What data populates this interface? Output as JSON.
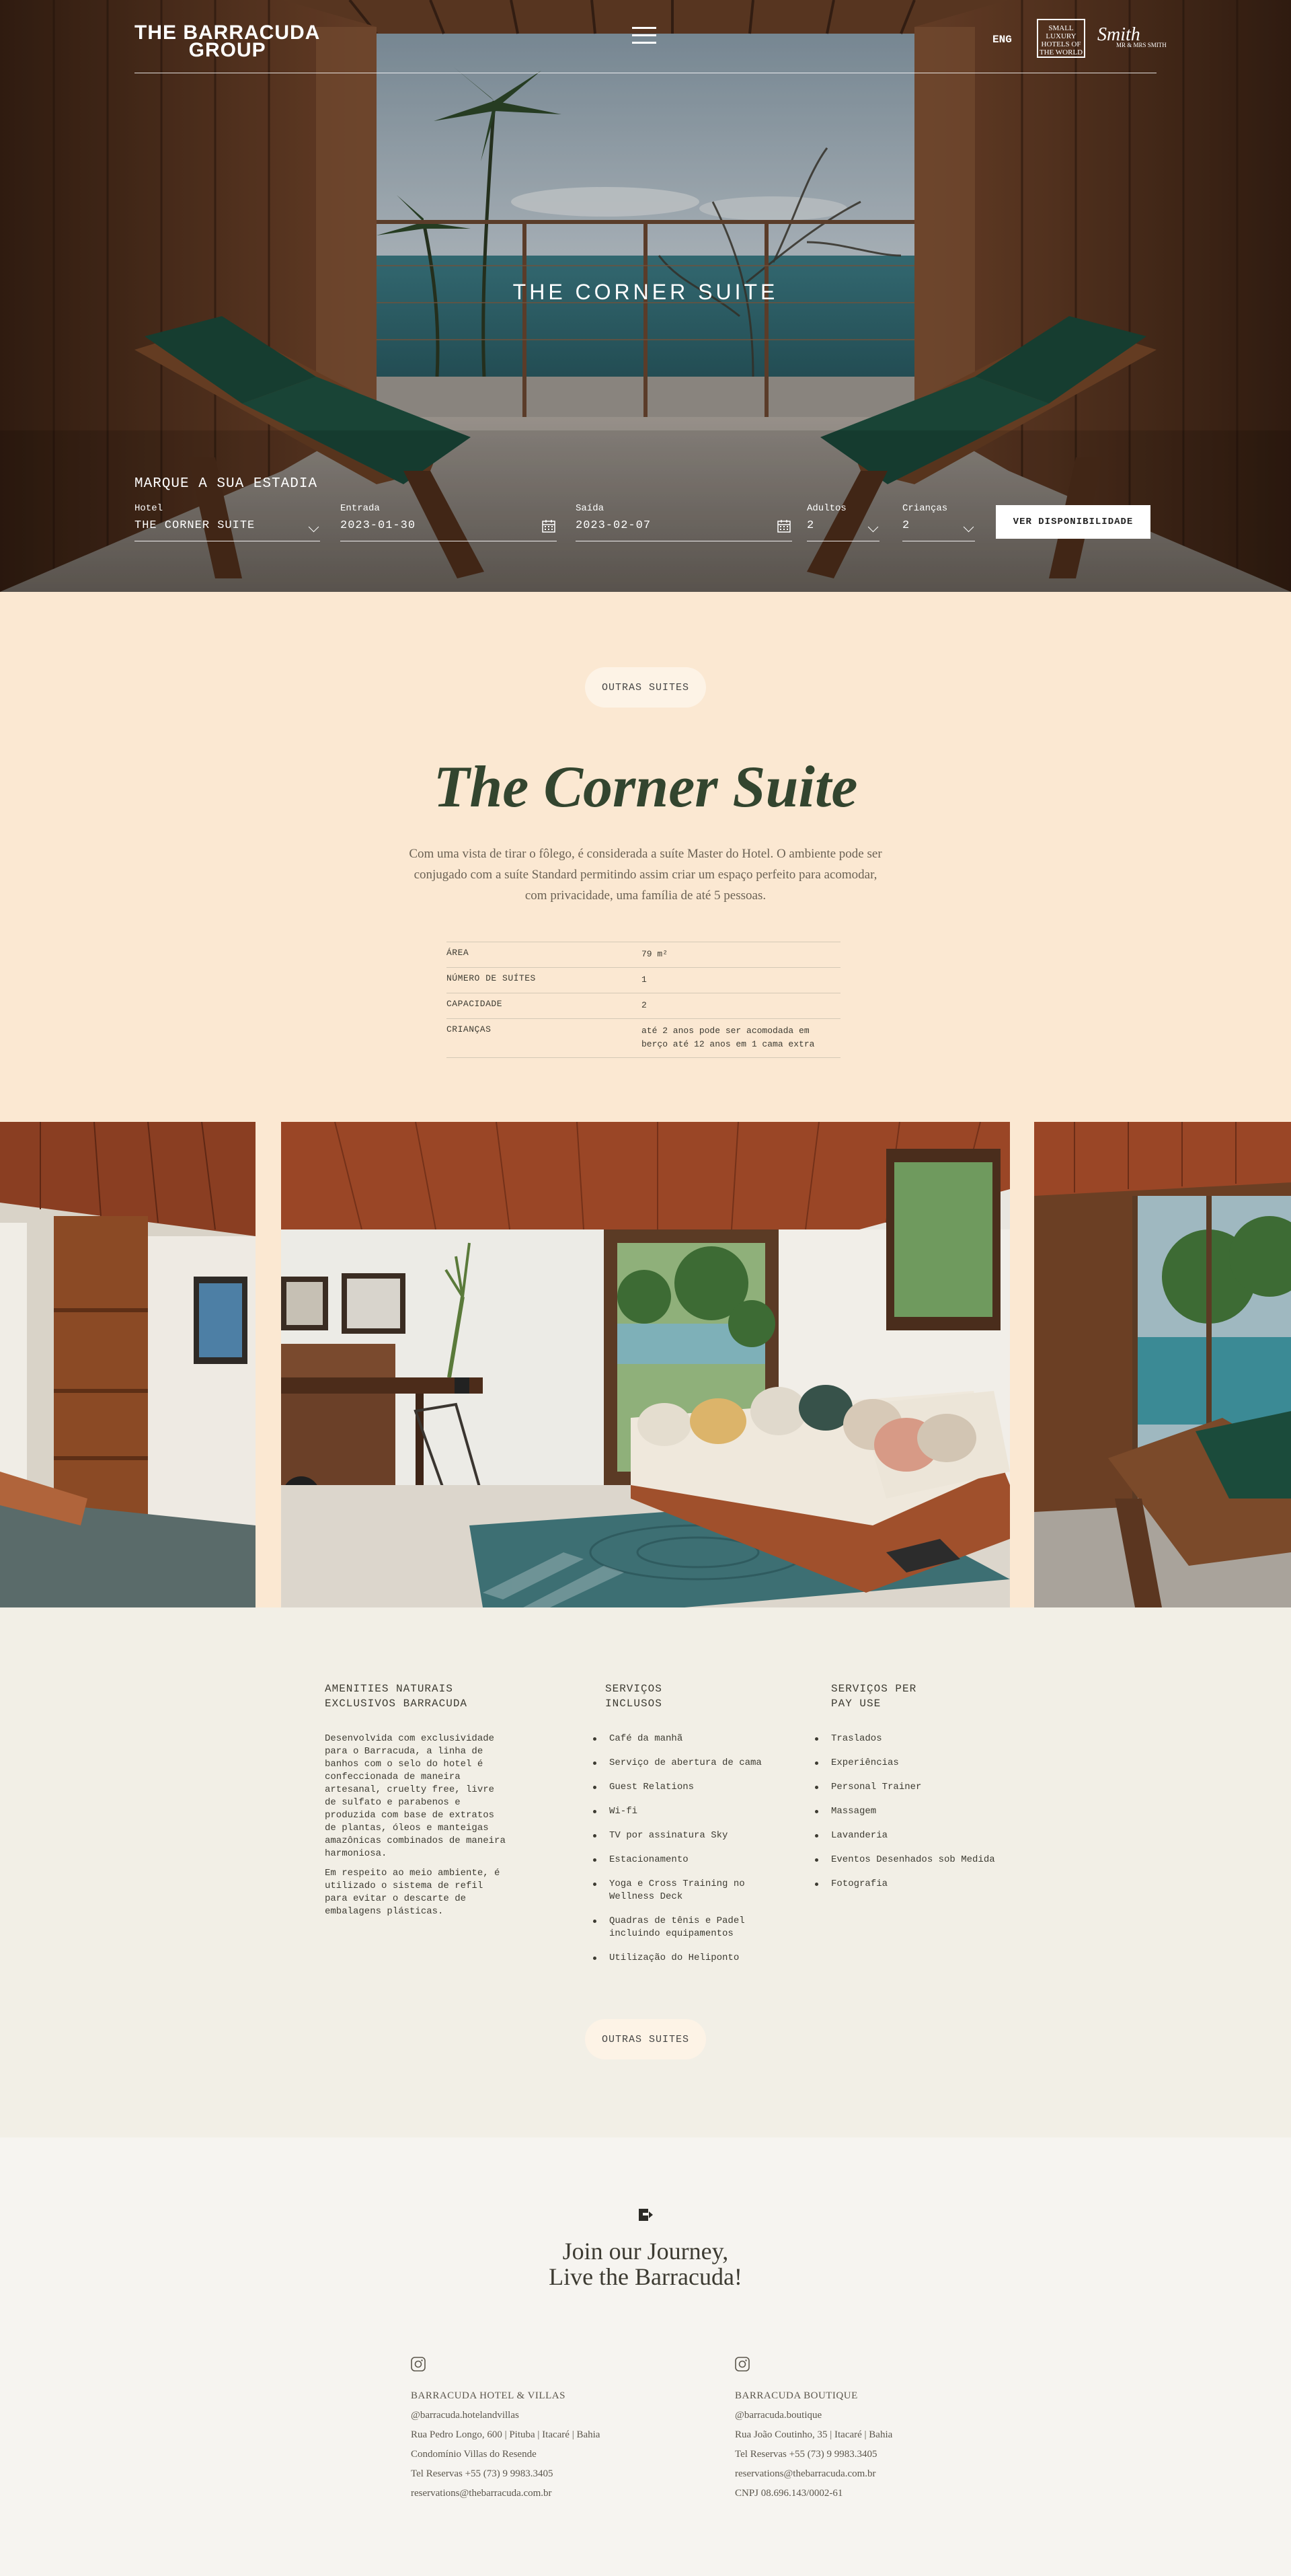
{
  "header": {
    "logo_line1": "THE BARRACUDA",
    "logo_line2": "GROUP",
    "menu_icon": "hamburger-menu-icon",
    "language": "ENG",
    "slh_logo": "SMALL LUXURY HOTELS OF THE WORLD",
    "smith_logo": "Smith",
    "smith_sub": "MR & MRS SMITH"
  },
  "hero": {
    "title": "THE CORNER SUITE"
  },
  "booking": {
    "heading": "MARQUE A SUA ESTADIA",
    "hotel_label": "Hotel",
    "hotel_value": "THE CORNER SUITE",
    "checkin_label": "Entrada",
    "checkin_value": "2023-01-30",
    "checkout_label": "Saída",
    "checkout_value": "2023-02-07",
    "adults_label": "Adultos",
    "adults_value": "2",
    "children_label": "Crianças",
    "children_value": "2",
    "button": "VER DISPONIBILIDADE"
  },
  "intro": {
    "pill_label": "OUTRAS SUITES",
    "title": "The Corner Suite",
    "description": "Com uma vista de tirar o fôlego, é considerada a suíte Master do Hotel. O ambiente pode ser conjugado com a suíte Standard permitindo assim criar um espaço perfeito para acomodar, com privacidade, uma família de até 5 pessoas.",
    "specs": [
      {
        "label": "ÁREA",
        "value": "79 m²"
      },
      {
        "label": "NÚMERO DE SUÍTES",
        "value": "1"
      },
      {
        "label": "CAPACIDADE",
        "value": "2"
      },
      {
        "label": "CRIANÇAS",
        "value": "até 2 anos pode ser acomodada em berço até 12 anos em 1 cama extra"
      }
    ]
  },
  "amenities": {
    "natural_heading": "AMENITIES NATURAIS EXCLUSIVOS BARRACUDA",
    "natural_p1": "Desenvolvida com exclusividade para o Barracuda, a linha de banhos com o selo do hotel é confeccionada de maneira artesanal, cruelty free, livre de sulfato e parabenos e produzida com base de extratos de plantas, óleos e manteigas amazônicas combinados de maneira harmoniosa.",
    "natural_p2": "Em respeito ao meio ambiente, é utilizado o sistema de refil para evitar o descarte de embalagens plásticas.",
    "included_heading": "SERVIÇOS INCLUSOS",
    "included": [
      "Café da manhã",
      "Serviço de abertura de cama",
      "Guest Relations",
      "Wi-fi",
      "TV por assinatura Sky",
      "Estacionamento",
      "Yoga e Cross Training no Wellness Deck",
      "Quadras de tênis e Padel incluindo equipamentos",
      "Utilização do Heliponto"
    ],
    "payperuse_heading": "SERVIÇOS PER PAY USE",
    "payperuse": [
      "Traslados",
      "Experiências",
      "Personal Trainer",
      "Massagem",
      "Lavanderia",
      "Eventos Desenhados sob Medida",
      "Fotografia"
    ],
    "pill_label": "OUTRAS SUITES"
  },
  "footer": {
    "mark_icon": "barracuda-mark-icon",
    "journey_line1": "Join our Journey,",
    "journey_line2": "Live the Barracuda!",
    "left": {
      "icon": "instagram-icon",
      "name": "BARRACUDA HOTEL & VILLAS",
      "handle": "@barracuda.hotelandvillas",
      "address": "Rua Pedro Longo, 600 | Pituba | Itacaré | Bahia",
      "condo": "Condomínio Villas do Resende",
      "phone": "Tel Reservas +55 (73) 9 9983.3405",
      "email": "reservations@thebarracuda.com.br"
    },
    "right": {
      "icon": "instagram-icon",
      "name": "BARRACUDA BOUTIQUE",
      "handle": "@barracuda.boutique",
      "address": "Rua João Coutinho, 35 | Itacaré | Bahia",
      "phone": "Tel Reservas +55 (73) 9 9983.3405",
      "email": "reservations@thebarracuda.com.br",
      "cnpj": "CNPJ 08.696.143/0002-61"
    }
  },
  "colors": {
    "peach": "#fbe8d2",
    "cream": "#f2efe6",
    "title_green": "#33452f",
    "text": "#3d3b32"
  }
}
